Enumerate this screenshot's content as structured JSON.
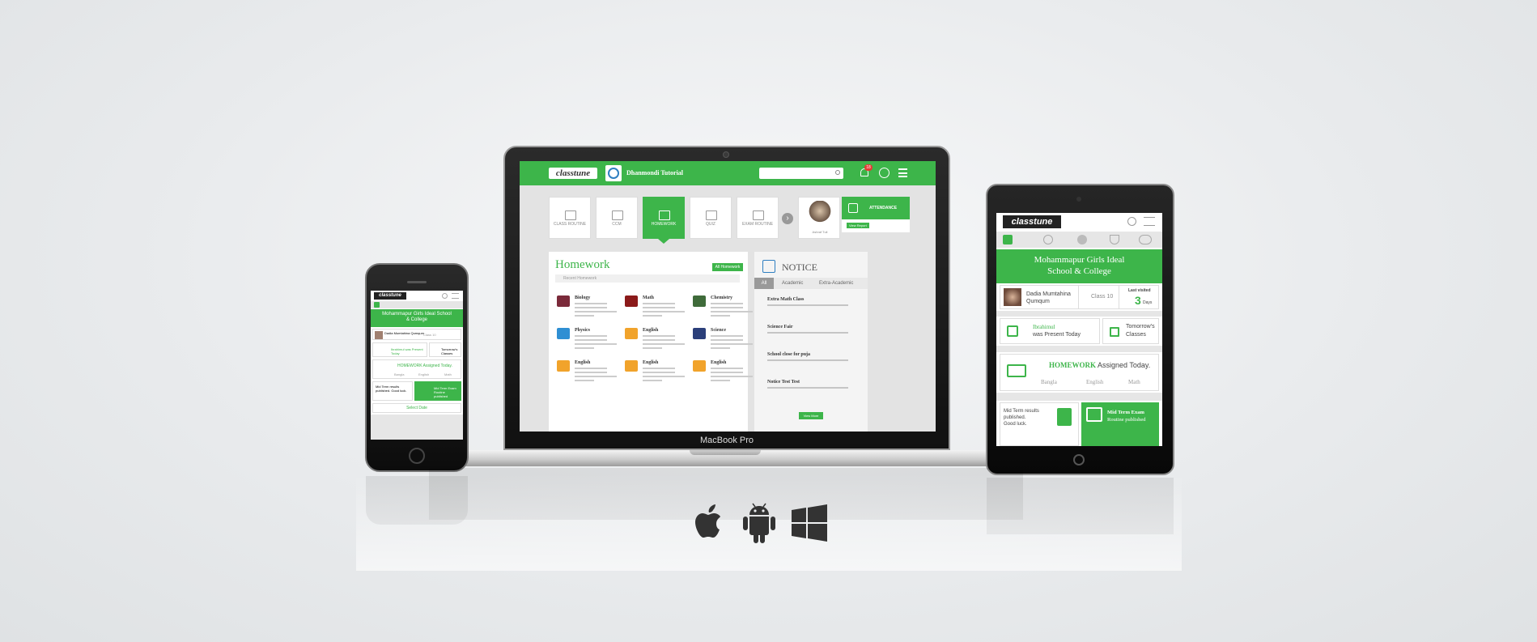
{
  "laptop": {
    "brand_label": "MacBook Pro",
    "app": {
      "logo": "classtune",
      "school": "Dhanmondi Tutorial",
      "notification_count": "18",
      "tiles": [
        {
          "label": "CLASS ROUTINE",
          "active": false
        },
        {
          "label": "CCM",
          "active": false
        },
        {
          "label": "HOMEWORK",
          "active": true
        },
        {
          "label": "QUIZ",
          "active": false
        },
        {
          "label": "EXAM ROUTINE",
          "active": false
        }
      ],
      "student": {
        "name": "Ashraf Tuli",
        "attendance_title": "ATTENDANCE",
        "view_report": "View Report"
      },
      "homework": {
        "title": "Homework",
        "all_button": "All Homework",
        "recent_label": "Recent Homework",
        "items": [
          {
            "subject": "Biology",
            "color": "#7b2a3a"
          },
          {
            "subject": "Math",
            "color": "#8b1a1a"
          },
          {
            "subject": "Chemistry",
            "color": "#3f6b3a"
          },
          {
            "subject": "Physics",
            "color": "#2f8fd3"
          },
          {
            "subject": "English",
            "color": "#f1a32b"
          },
          {
            "subject": "Science",
            "color": "#2b3f7a"
          },
          {
            "subject": "English",
            "color": "#f1a32b"
          },
          {
            "subject": "English",
            "color": "#f1a32b"
          },
          {
            "subject": "English",
            "color": "#f1a32b"
          }
        ]
      },
      "notice": {
        "title": "NOTICE",
        "tabs": [
          "All",
          "Academic",
          "Extra-Academic"
        ],
        "items": [
          "Extra Math Class",
          "Science Fair",
          "School close for puja",
          "Notice Test Test"
        ],
        "view_more": "View More"
      }
    }
  },
  "phone": {
    "logo": "classtune",
    "school": "Mohammapur Girls Ideal School & College",
    "student_name": "Dadia Mumtahina Qumqum",
    "class": "Class 10",
    "attendance": "Ibrahimul was Present Today",
    "tomorrow": "Tomorrow's Classes",
    "homework_heading": "HOMEWORK Assigned Today.",
    "subjects": [
      "Bangla",
      "English",
      "Math"
    ],
    "results": "Mid Term results published. Good luck.",
    "exam": "Mid Term Exam Routine published",
    "select_date": "Select Date"
  },
  "tablet": {
    "logo": "classtune",
    "school_line1": "Mohammapur Girls Ideal",
    "school_line2": "School & College",
    "student_name_1": "Dadia Mumtahina",
    "student_name_2": "Qumqum",
    "class": "Class 10",
    "last_visited": "Last visited",
    "days_number": "3",
    "days_unit": "Days",
    "attendance_name": "Ibrahimul",
    "attendance_text": "was Present Today",
    "tomorrow_1": "Tomorrow's",
    "tomorrow_2": "Classes",
    "homework_bold": "HOMEWORK",
    "homework_rest": " Assigned Today.",
    "subjects": [
      "Bangla",
      "English",
      "Math"
    ],
    "results_1": "Mid Term results",
    "results_2": "published.",
    "results_3": "Good luck.",
    "exam_1": "Mid Term Exam",
    "exam_2": "Routine published"
  },
  "platforms": [
    "apple-icon",
    "android-icon",
    "windows-icon"
  ],
  "colors": {
    "accent": "#3db54a",
    "dark": "#111111",
    "background": "#e9ebed"
  }
}
